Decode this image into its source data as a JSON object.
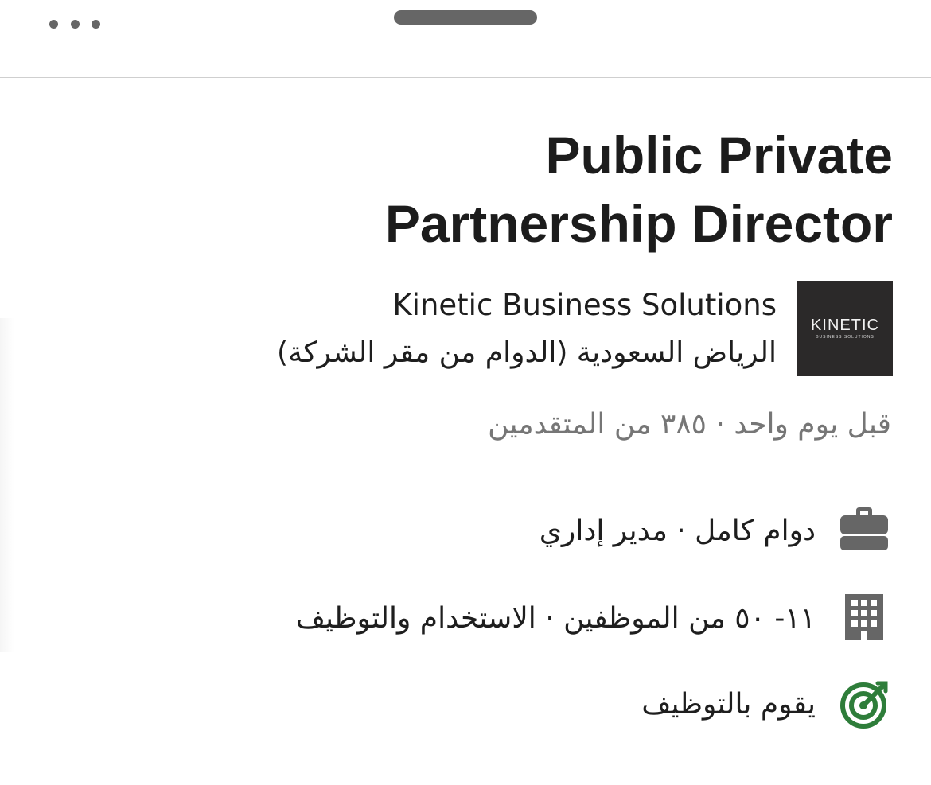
{
  "header": {
    "more_icon": "more-horizontal-icon",
    "handle": "drag-handle"
  },
  "job": {
    "title": "Public Private Partnership Director"
  },
  "company": {
    "name": "Kinetic Business Solutions",
    "location": "الرياض السعودية (الدوام من مقر الشركة)",
    "logo_text": "KINETIC",
    "logo_subtext": "BUSINESS SOLUTIONS",
    "logo_bg": "#2b2929"
  },
  "meta": {
    "posted": "قبل  يوم واحد · ٣٨٥ من المتقدمين"
  },
  "insights": [
    {
      "icon": "briefcase-icon",
      "text": "دوام كامل · مدير إداري",
      "color": "#666666"
    },
    {
      "icon": "building-icon",
      "text": "١١- ٥٠ من الموظفين · الاستخدام والتوظيف",
      "color": "#666666"
    },
    {
      "icon": "target-icon",
      "text": "يقوم بالتوظيف",
      "color": "#2e7d3a"
    }
  ]
}
